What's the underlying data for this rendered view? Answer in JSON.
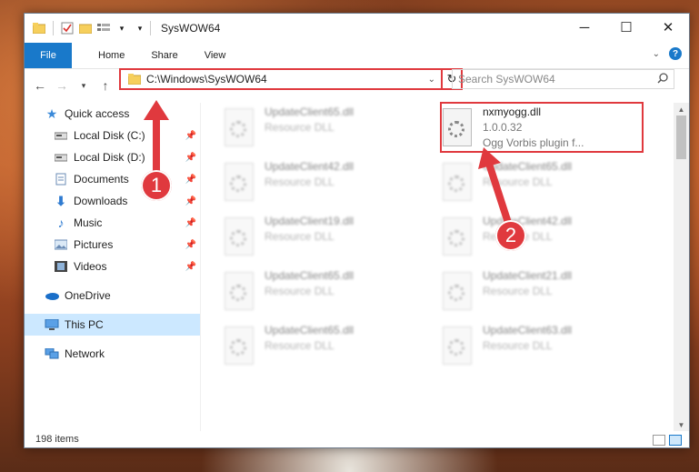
{
  "window": {
    "title": "SysWOW64",
    "quick_access_toolbar": [
      "folder-icon",
      "properties-icon",
      "new-folder-icon",
      "customize-icon"
    ]
  },
  "ribbon": {
    "tabs": [
      "File",
      "Home",
      "Share",
      "View"
    ]
  },
  "nav": {
    "address": "C:\\Windows\\SysWOW64",
    "search_placeholder": "Search SysWOW64"
  },
  "sidebar": {
    "items": [
      {
        "label": "Quick access",
        "icon": "star-icon"
      },
      {
        "label": "Local Disk (C:)",
        "icon": "disk-icon",
        "pinned": true
      },
      {
        "label": "Local Disk (D:)",
        "icon": "disk-icon",
        "pinned": true
      },
      {
        "label": "Documents",
        "icon": "documents-icon",
        "pinned": true
      },
      {
        "label": "Downloads",
        "icon": "downloads-icon",
        "pinned": true
      },
      {
        "label": "Music",
        "icon": "music-icon",
        "pinned": true
      },
      {
        "label": "Pictures",
        "icon": "pictures-icon",
        "pinned": true
      },
      {
        "label": "Videos",
        "icon": "videos-icon",
        "pinned": true
      },
      {
        "label": "OneDrive",
        "icon": "onedrive-icon"
      },
      {
        "label": "This PC",
        "icon": "pc-icon",
        "selected": true
      },
      {
        "label": "Network",
        "icon": "network-icon"
      }
    ]
  },
  "files": {
    "highlighted": {
      "name": "nxmyogg.dll",
      "version": "1.0.0.32",
      "description": "Ogg Vorbis plugin f..."
    },
    "left_column": [
      {
        "name": "UpdateClient65.dll",
        "type": "Resource DLL"
      },
      {
        "name": "UpdateClient42.dll",
        "type": "Resource DLL"
      },
      {
        "name": "UpdateClient19.dll",
        "type": "Resource DLL"
      },
      {
        "name": "UpdateClient65.dll",
        "type": "Resource DLL"
      },
      {
        "name": "UpdateClient65.dll",
        "type": "Resource DLL"
      }
    ],
    "right_column": [
      {
        "name": "UpdateClient65.dll",
        "type": "Resource DLL"
      },
      {
        "name": "UpdateClient42.dll",
        "type": "Resource DLL"
      },
      {
        "name": "UpdateClient21.dll",
        "type": "Resource DLL"
      },
      {
        "name": "UpdateClient63.dll",
        "type": "Resource DLL"
      }
    ]
  },
  "status": {
    "item_count": "198 items"
  },
  "annotations": {
    "step1": "1",
    "step2": "2",
    "color": "#e0393e"
  }
}
